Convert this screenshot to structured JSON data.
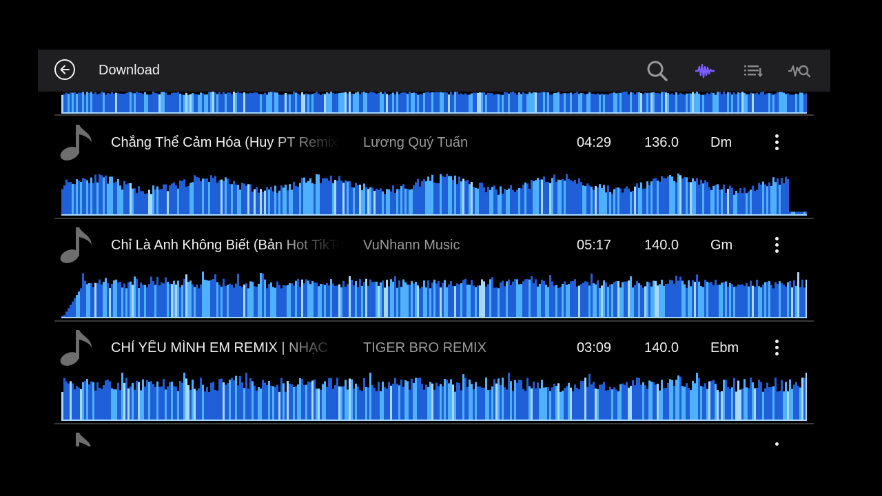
{
  "header": {
    "title": "Download",
    "icons": [
      "back-icon",
      "search-icon",
      "waveform-icon",
      "playlist-sort-icon",
      "waveform-search-icon"
    ],
    "active_color": "#7b5cff"
  },
  "tracks": [
    {
      "title": "Chẳng Thể Cảm Hóa (Huy PT Remix)",
      "artist": "Lương Quý Tuấn",
      "duration": "04:29",
      "bpm": "136.0",
      "key": "Dm"
    },
    {
      "title": "Chỉ Là Anh Không Biết (Bản Hot TikTok)",
      "artist": "VuNhann Music",
      "duration": "05:17",
      "bpm": "140.0",
      "key": "Gm"
    },
    {
      "title": "CHỈ YÊU MÌNH EM REMIX  | NHẠC",
      "artist": "TIGER BRO REMIX",
      "duration": "03:09",
      "bpm": "140.0",
      "key": "Ebm"
    }
  ],
  "colors": {
    "wave_deep": "#1f5fd8",
    "wave_light": "#4fb0ff",
    "wave_pale": "#a9d8ff"
  }
}
